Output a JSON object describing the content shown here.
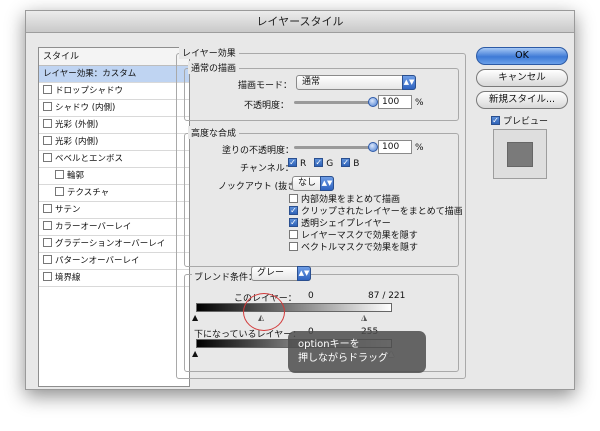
{
  "dialog": {
    "title": "レイヤースタイル"
  },
  "styles_panel": {
    "header": "スタイル",
    "items": [
      {
        "label": "レイヤー効果：カスタム",
        "checkbox": false,
        "selected": true,
        "indent": false
      },
      {
        "label": "ドロップシャドウ",
        "checkbox": true,
        "checked": false,
        "indent": false
      },
      {
        "label": "シャドウ (内側)",
        "checkbox": true,
        "checked": false,
        "indent": false
      },
      {
        "label": "光彩 (外側)",
        "checkbox": true,
        "checked": false,
        "indent": false
      },
      {
        "label": "光彩 (内側)",
        "checkbox": true,
        "checked": false,
        "indent": false
      },
      {
        "label": "ベベルとエンボス",
        "checkbox": true,
        "checked": false,
        "indent": false
      },
      {
        "label": "輪郭",
        "checkbox": true,
        "checked": false,
        "indent": true
      },
      {
        "label": "テクスチャ",
        "checkbox": true,
        "checked": false,
        "indent": true
      },
      {
        "label": "サテン",
        "checkbox": true,
        "checked": false,
        "indent": false
      },
      {
        "label": "カラーオーバーレイ",
        "checkbox": true,
        "checked": false,
        "indent": false
      },
      {
        "label": "グラデーションオーバーレイ",
        "checkbox": true,
        "checked": false,
        "indent": false
      },
      {
        "label": "パターンオーバーレイ",
        "checkbox": true,
        "checked": false,
        "indent": false
      },
      {
        "label": "境界線",
        "checkbox": true,
        "checked": false,
        "indent": false
      }
    ]
  },
  "layer_effects": {
    "title": "レイヤー効果",
    "general": {
      "title": "通常の描画",
      "blend_mode_label": "描画モード：",
      "blend_mode_value": "通常",
      "opacity_label": "不透明度：",
      "opacity_value": "100",
      "opacity_unit": "%",
      "opacity_level": 1.0
    },
    "advanced": {
      "title": "高度な合成",
      "fill_opacity_label": "塗りの不透明度：",
      "fill_opacity_value": "100",
      "fill_opacity_unit": "%",
      "fill_opacity_level": 1.0,
      "channels_label": "チャンネル：",
      "channels": [
        {
          "label": "R",
          "checked": true
        },
        {
          "label": "G",
          "checked": true
        },
        {
          "label": "B",
          "checked": true
        }
      ],
      "knockout_label": "ノックアウト (抜き)：",
      "knockout_value": "なし",
      "options": [
        {
          "label": "内部効果をまとめて描画",
          "checked": false
        },
        {
          "label": "クリップされたレイヤーをまとめて描画",
          "checked": true
        },
        {
          "label": "透明シェイプレイヤー",
          "checked": true
        },
        {
          "label": "レイヤーマスクで効果を隠す",
          "checked": false
        },
        {
          "label": "ベクトルマスクで効果を隠す",
          "checked": false
        }
      ]
    },
    "blend_if": {
      "label": "ブレンド条件：",
      "value": "グレー",
      "this_layer_label": "このレイヤー：",
      "this_layer_min": "0",
      "this_layer_max": "87 / 221",
      "underlying_label": "下になっているレイヤー：",
      "underlying_min": "0",
      "underlying_max": "255"
    }
  },
  "buttons": {
    "ok": "OK",
    "cancel": "キャンセル",
    "new_style": "新規スタイル...",
    "preview_label": "プレビュー",
    "preview_checked": true
  },
  "tooltip": {
    "line1": "optionキーを",
    "line2": "押しながらドラッグ"
  },
  "colors": {
    "accent": "#3e7ad6",
    "selection": "#bfd4f2",
    "annotation_ring": "#d23a3a"
  }
}
